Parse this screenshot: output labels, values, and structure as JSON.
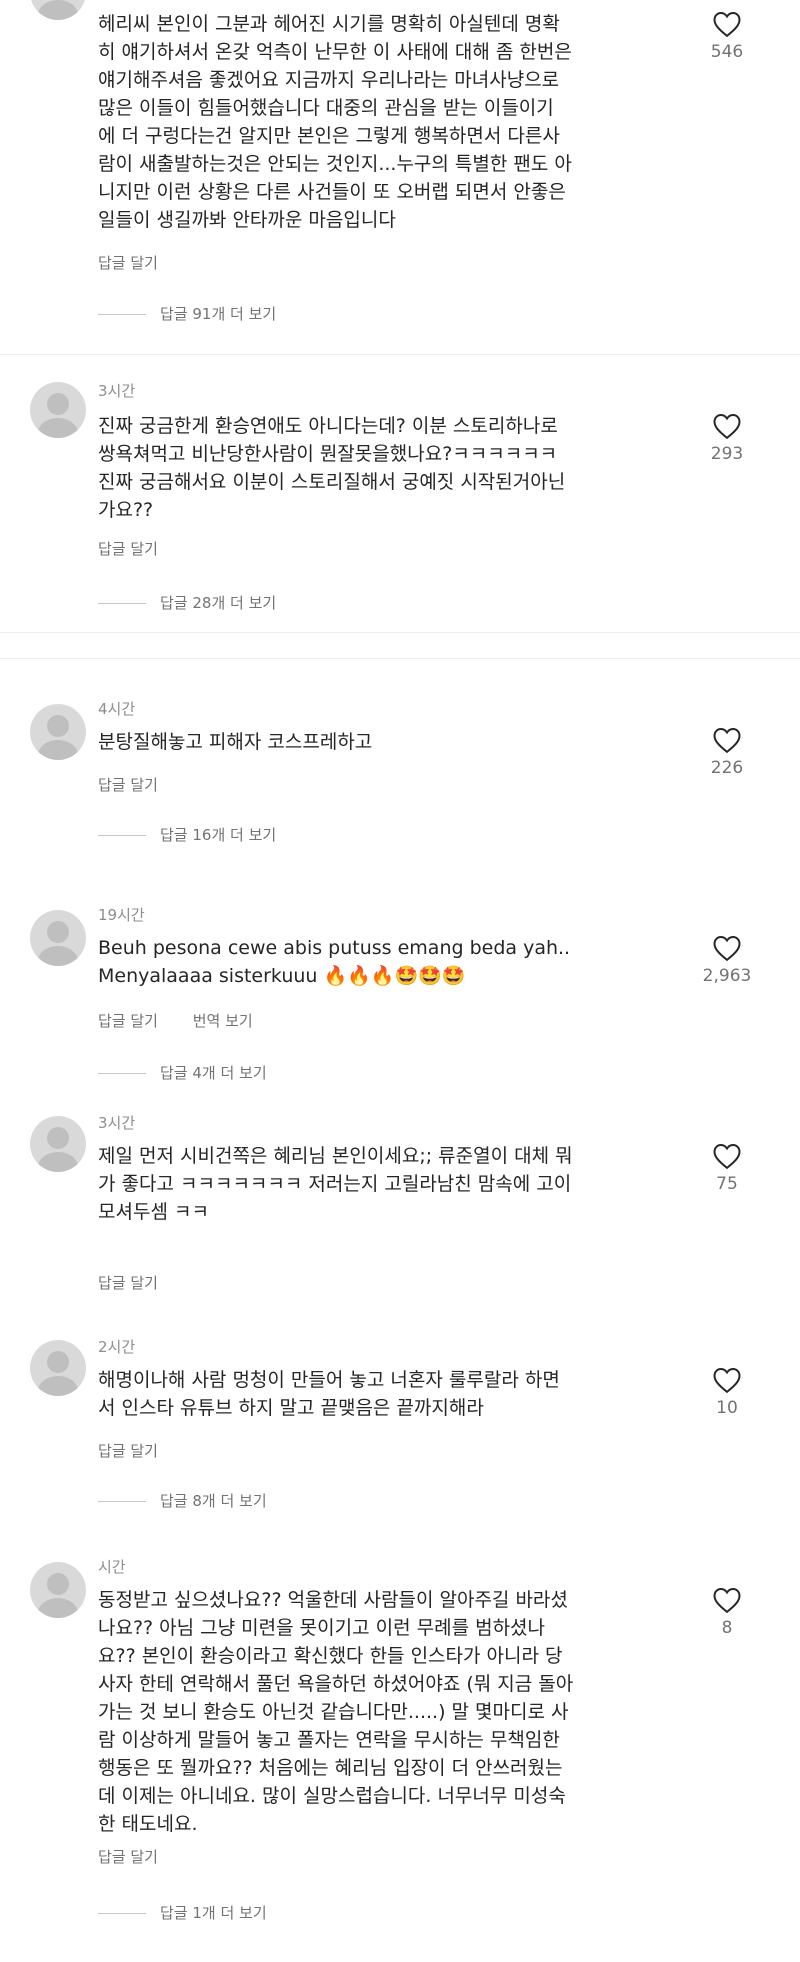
{
  "comments": [
    {
      "username": "",
      "time": "",
      "text": "헤리씨 본인이 그분과 헤어진 시기를 명확히 아실텐데 명확\n히 얘기하셔서 온갖 억측이 난무한 이 사태에 대해 좀 한번은\n얘기해주셔음 좋겠어요  지금까지 우리나라는 마녀사냥으로\n많은 이들이 힘들어했습니다  대중의 관심을 받는 이들이기\n에 더 구렁다는건 알지만 본인은 그렇게 행복하면서 다른사\n람이 새출발하는것은 안되는 것인지...누구의 특별한 팬도 아\n니지만 이런 상황은 다른 사건들이 또 오버랩 되면서 안좋은\n일들이 생길까봐 안타까운 마음입니다",
      "reply": "답글 달기",
      "translate": "",
      "likes": "546",
      "view_replies": "답글 91개 더 보기"
    },
    {
      "username": "",
      "time": "3시간",
      "text": "진짜 궁금한게 환승연애도 아니다는데? 이분 스토리하나로\n쌍욕쳐먹고 비난당한사람이 뭔잘못을했나요?ㅋㅋㅋㅋㅋㅋ\n진짜 궁금해서요 이분이 스토리질해서 궁예짓 시작된거아닌\n가요??",
      "reply": "답글 달기",
      "translate": "",
      "likes": "293",
      "view_replies": "답글 28개 더 보기"
    },
    {
      "username": "",
      "time": "4시간",
      "text": "분탕질해놓고 피해자 코스프레하고",
      "reply": "답글 달기",
      "translate": "",
      "likes": "226",
      "view_replies": "답글 16개 더 보기"
    },
    {
      "username": "",
      "time": "19시간",
      "text": "Beuh pesona cewe abis putuss emang beda yah..\nMenyalaaaa sisterkuuu 🔥🔥🔥🤩🤩🤩",
      "reply": "답글 달기",
      "translate": "번역 보기",
      "likes": "2,963",
      "view_replies": "답글 4개 더 보기"
    },
    {
      "username": "",
      "time": "3시간",
      "text": "제일 먼저 시비건쪽은 혜리님 본인이세요;; 류준열이 대체 뭐\n가 좋다고 ㅋㅋㅋㅋㅋㅋㅋ 저러는지 고릴라남친 맘속에 고이\n모셔두셈 ㅋㅋ",
      "reply": "답글 달기",
      "translate": "",
      "likes": "75",
      "view_replies": ""
    },
    {
      "username": "",
      "time": "2시간",
      "text": "해명이나해 사람 멍청이 만들어 놓고 너혼자 룰루랄라 하면\n서 인스타 유튜브 하지 말고 끝맺음은 끝까지해라",
      "reply": "답글 달기",
      "translate": "",
      "likes": "10",
      "view_replies": "답글 8개 더 보기"
    },
    {
      "username": "",
      "time": "시간",
      "text": "동정받고 싶으셨나요?? 억울한데 사람들이 알아주길 바라셨\n나요?? 아님 그냥 미련을 못이기고 이런 무례를 범하셨나\n요?? 본인이 환승이라고 확신했다 한들 인스타가 아니라 당\n사자 한테 연락해서 풀던 욕을하던 하셨어야죠 (뭐 지금 돌아\n가는 것 보니 환승도 아닌것 같습니다만.....) 말 몇마디로 사\n람 이상하게 말들어 놓고 폴자는 연락을 무시하는 무책임한\n행동은 또 뭘까요?? 처음에는 혜리님 입장이 더 안쓰러웠는\n데 이제는 아니네요. 많이 실망스럽습니다. 너무너무 미성숙\n한 태도네요.",
      "reply": "답글 달기",
      "translate": "",
      "likes": "8",
      "view_replies": "답글 1개 더 보기"
    }
  ]
}
